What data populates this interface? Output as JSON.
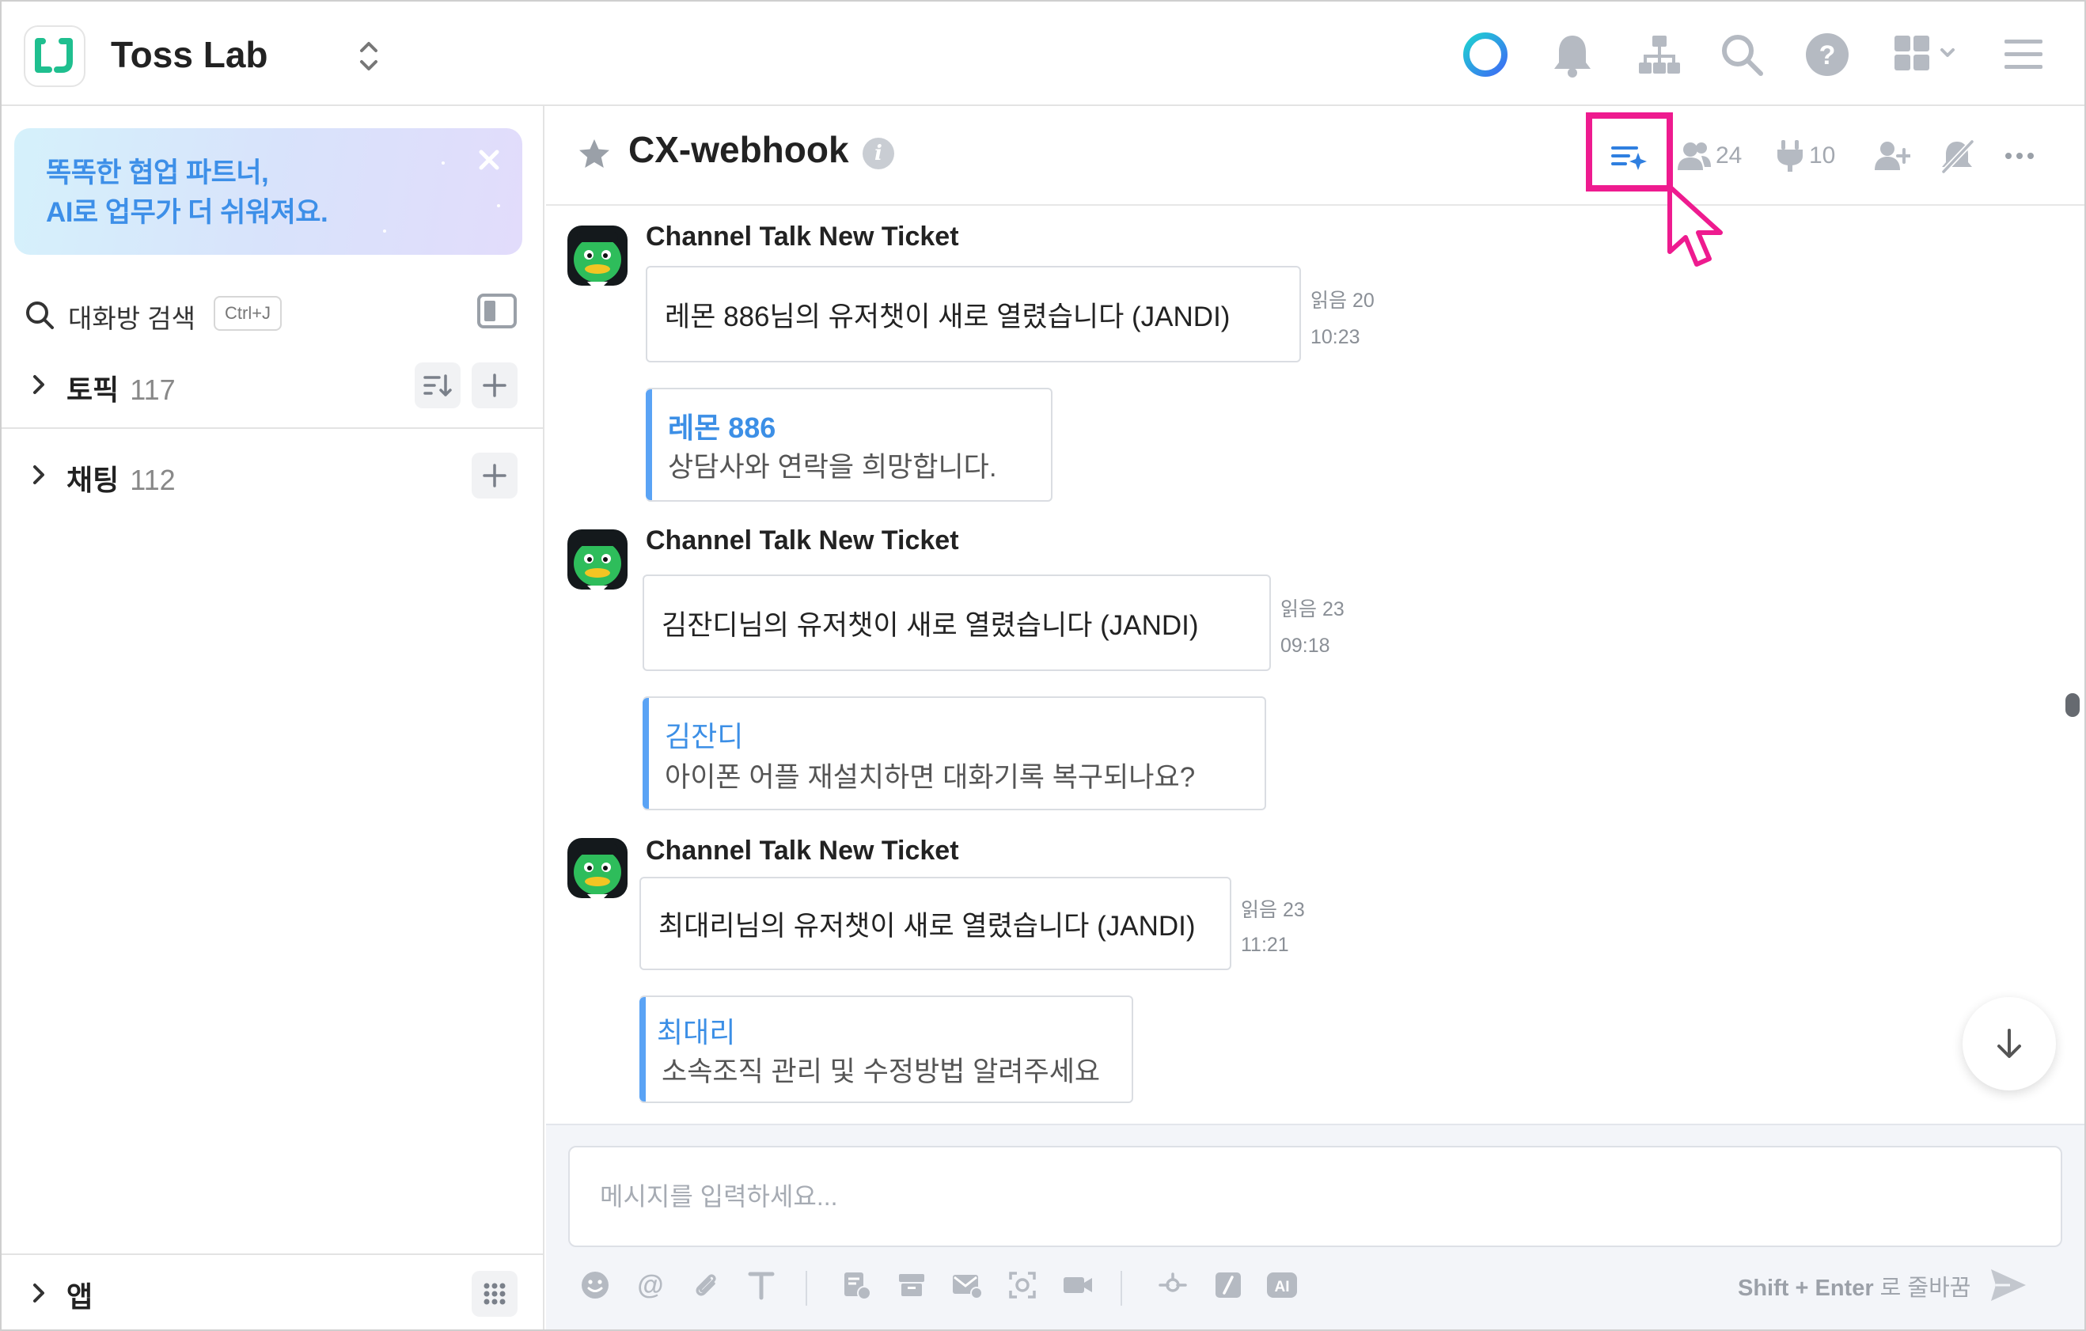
{
  "top_bar": {
    "team_name": "Toss Lab",
    "icons": [
      "loading-ring-icon",
      "bell-icon",
      "org-chart-icon",
      "search-icon",
      "help-icon",
      "apps-grid-icon",
      "hamburger-menu-icon"
    ]
  },
  "sidebar": {
    "ai_banner": {
      "line1": "똑똑한 협업 파트너,",
      "line2": "AI로 업무가 더 쉬워져요."
    },
    "search": {
      "label": "대화방 검색",
      "shortcut": "Ctrl+J"
    },
    "sections": [
      {
        "title": "토픽",
        "count": "117"
      },
      {
        "title": "채팅",
        "count": "112"
      }
    ],
    "bottom": {
      "title": "앱"
    }
  },
  "channel": {
    "name": "CX-webhook",
    "member_count": "24",
    "connect_count": "10"
  },
  "messages": [
    {
      "sender": "Channel Talk New Ticket",
      "text": "레몬 886님의 유저챗이 새로 열렸습니다 (JANDI)",
      "read": "읽음 20",
      "time": "10:23",
      "attachment": {
        "title": "레몬 886",
        "body": "상담사와 연락을 희망합니다."
      }
    },
    {
      "sender": "Channel Talk New Ticket",
      "text": "김잔디님의 유저챗이 새로 열렸습니다 (JANDI)",
      "read": "읽음 23",
      "time": "09:18",
      "attachment": {
        "title": "김잔디",
        "body": "아이폰 어플 재설치하면 대화기록 복구되나요?"
      }
    },
    {
      "sender": "Channel Talk New Ticket",
      "text": "최대리님의 유저챗이 새로 열렸습니다 (JANDI)",
      "read": "읽음 23",
      "time": "11:21",
      "attachment": {
        "title": "최대리",
        "body": "소속조직 관리 및 수정방법 알려주세요"
      }
    }
  ],
  "composer": {
    "placeholder": "메시지를 입력하세요...",
    "hint_keys": "Shift + Enter",
    "hint_text": "로 줄바꿈",
    "ai_label": "AI"
  },
  "colors": {
    "accent_blue": "#3c8fe6",
    "highlight_magenta": "#ee1b8f",
    "logo_green": "#1fbf8f",
    "icon_gray": "#b5bac2"
  }
}
